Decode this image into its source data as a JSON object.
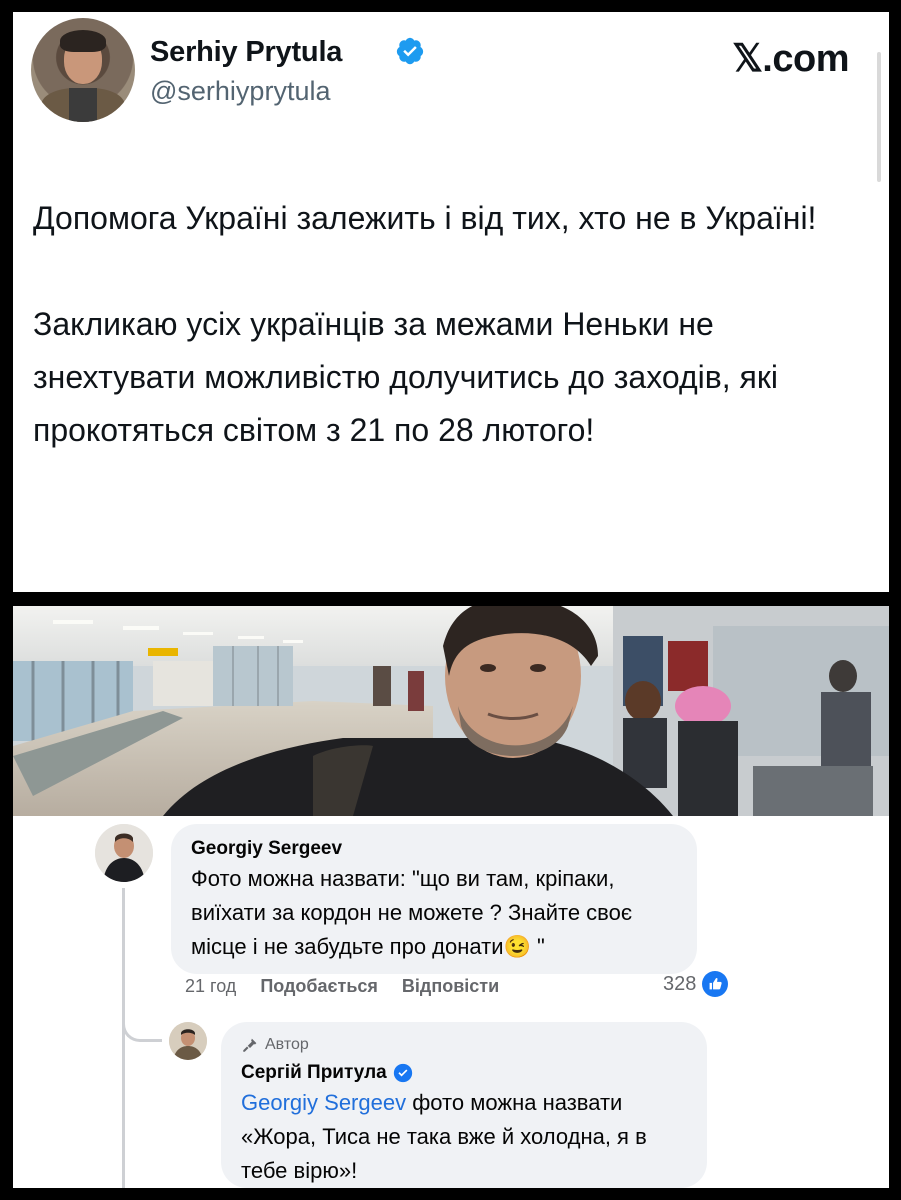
{
  "tweet": {
    "display_name": "Serhiy Prytula",
    "handle": "@serhiyprytula",
    "site": "𝕏.com",
    "paragraphs": [
      "Допомога Україні залежить і від тих, хто не в Україні!",
      "Закликаю усіх українців за межами Неньки не знехтувати можливістю долучитись до заходів, які прокотяться світом з 21 по 28 лютого!"
    ],
    "accent_color": "#1d9bf0"
  },
  "comments": {
    "first": {
      "author": "Georgiy Sergeev",
      "text": "Фото можна назвати: \"що ви там, кріпаки, виїхати за кордон не можете ? Знайте своє місце і не забудьте про донати😉 \"",
      "time": "21 год",
      "like_label": "Подобається",
      "reply_label": "Відповісти",
      "reaction_count": "328"
    },
    "reply": {
      "author_badge": "Автор",
      "author": "Сергій Притула",
      "mention": "Georgiy Sergeev",
      "text": " фото можна назвати «Жора, Тиса не така вже й холодна, я в тебе вірю»!"
    }
  }
}
